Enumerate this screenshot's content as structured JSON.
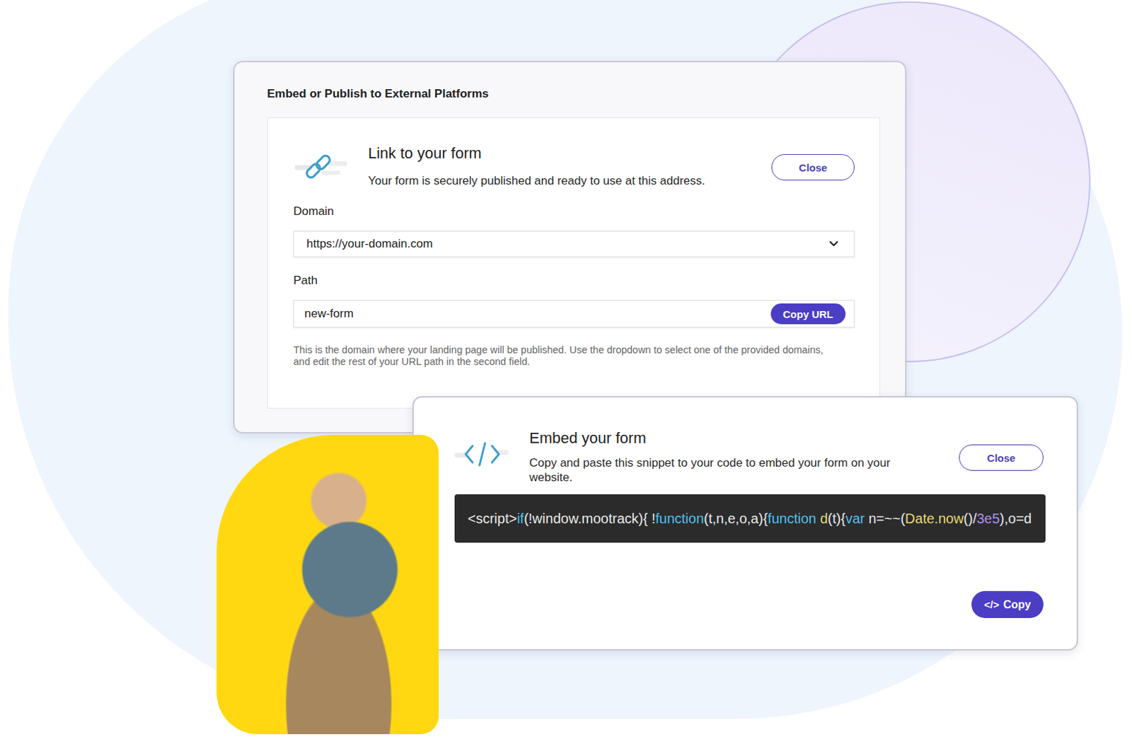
{
  "publish_panel": {
    "title": "Embed or Publish to External Platforms"
  },
  "link_card": {
    "title": "Link to your form",
    "subtitle": "Your form is securely published and ready to use at this address.",
    "close": "Close",
    "domain_label": "Domain",
    "domain_value": "https://your-domain.com",
    "path_label": "Path",
    "path_value": "new-form",
    "copy_url": "Copy URL",
    "help": "This is the domain where your landing page will be published. Use the dropdown to select one of the provided domains, and edit the rest of your URL path in the second field."
  },
  "embed_card": {
    "title": "Embed your form",
    "subtitle": "Copy and paste this snippet to your code to embed your form on your website.",
    "close": "Close",
    "snippet": [
      {
        "text": "<script>",
        "color": "#eaeaea"
      },
      {
        "text": "if",
        "color": "#4fc1e9"
      },
      {
        "text": "(!window.mootrack){ !",
        "color": "#eaeaea"
      },
      {
        "text": "function",
        "color": "#4fc1e9"
      },
      {
        "text": "(t,n,e,o,a){",
        "color": "#eaeaea"
      },
      {
        "text": "function",
        "color": "#4fc1e9"
      },
      {
        "text": " ",
        "color": "#eaeaea"
      },
      {
        "text": "d",
        "color": "#e6d873"
      },
      {
        "text": "(t){",
        "color": "#eaeaea"
      },
      {
        "text": "var",
        "color": "#4fc1e9"
      },
      {
        "text": " n=~~(",
        "color": "#eaeaea"
      },
      {
        "text": "Date.now",
        "color": "#e6d873"
      },
      {
        "text": "()/",
        "color": "#eaeaea"
      },
      {
        "text": "3e5",
        "color": "#b38df2"
      },
      {
        "text": "),o=d",
        "color": "#eaeaea"
      }
    ],
    "copy_icon": "</>",
    "copy": "Copy"
  }
}
